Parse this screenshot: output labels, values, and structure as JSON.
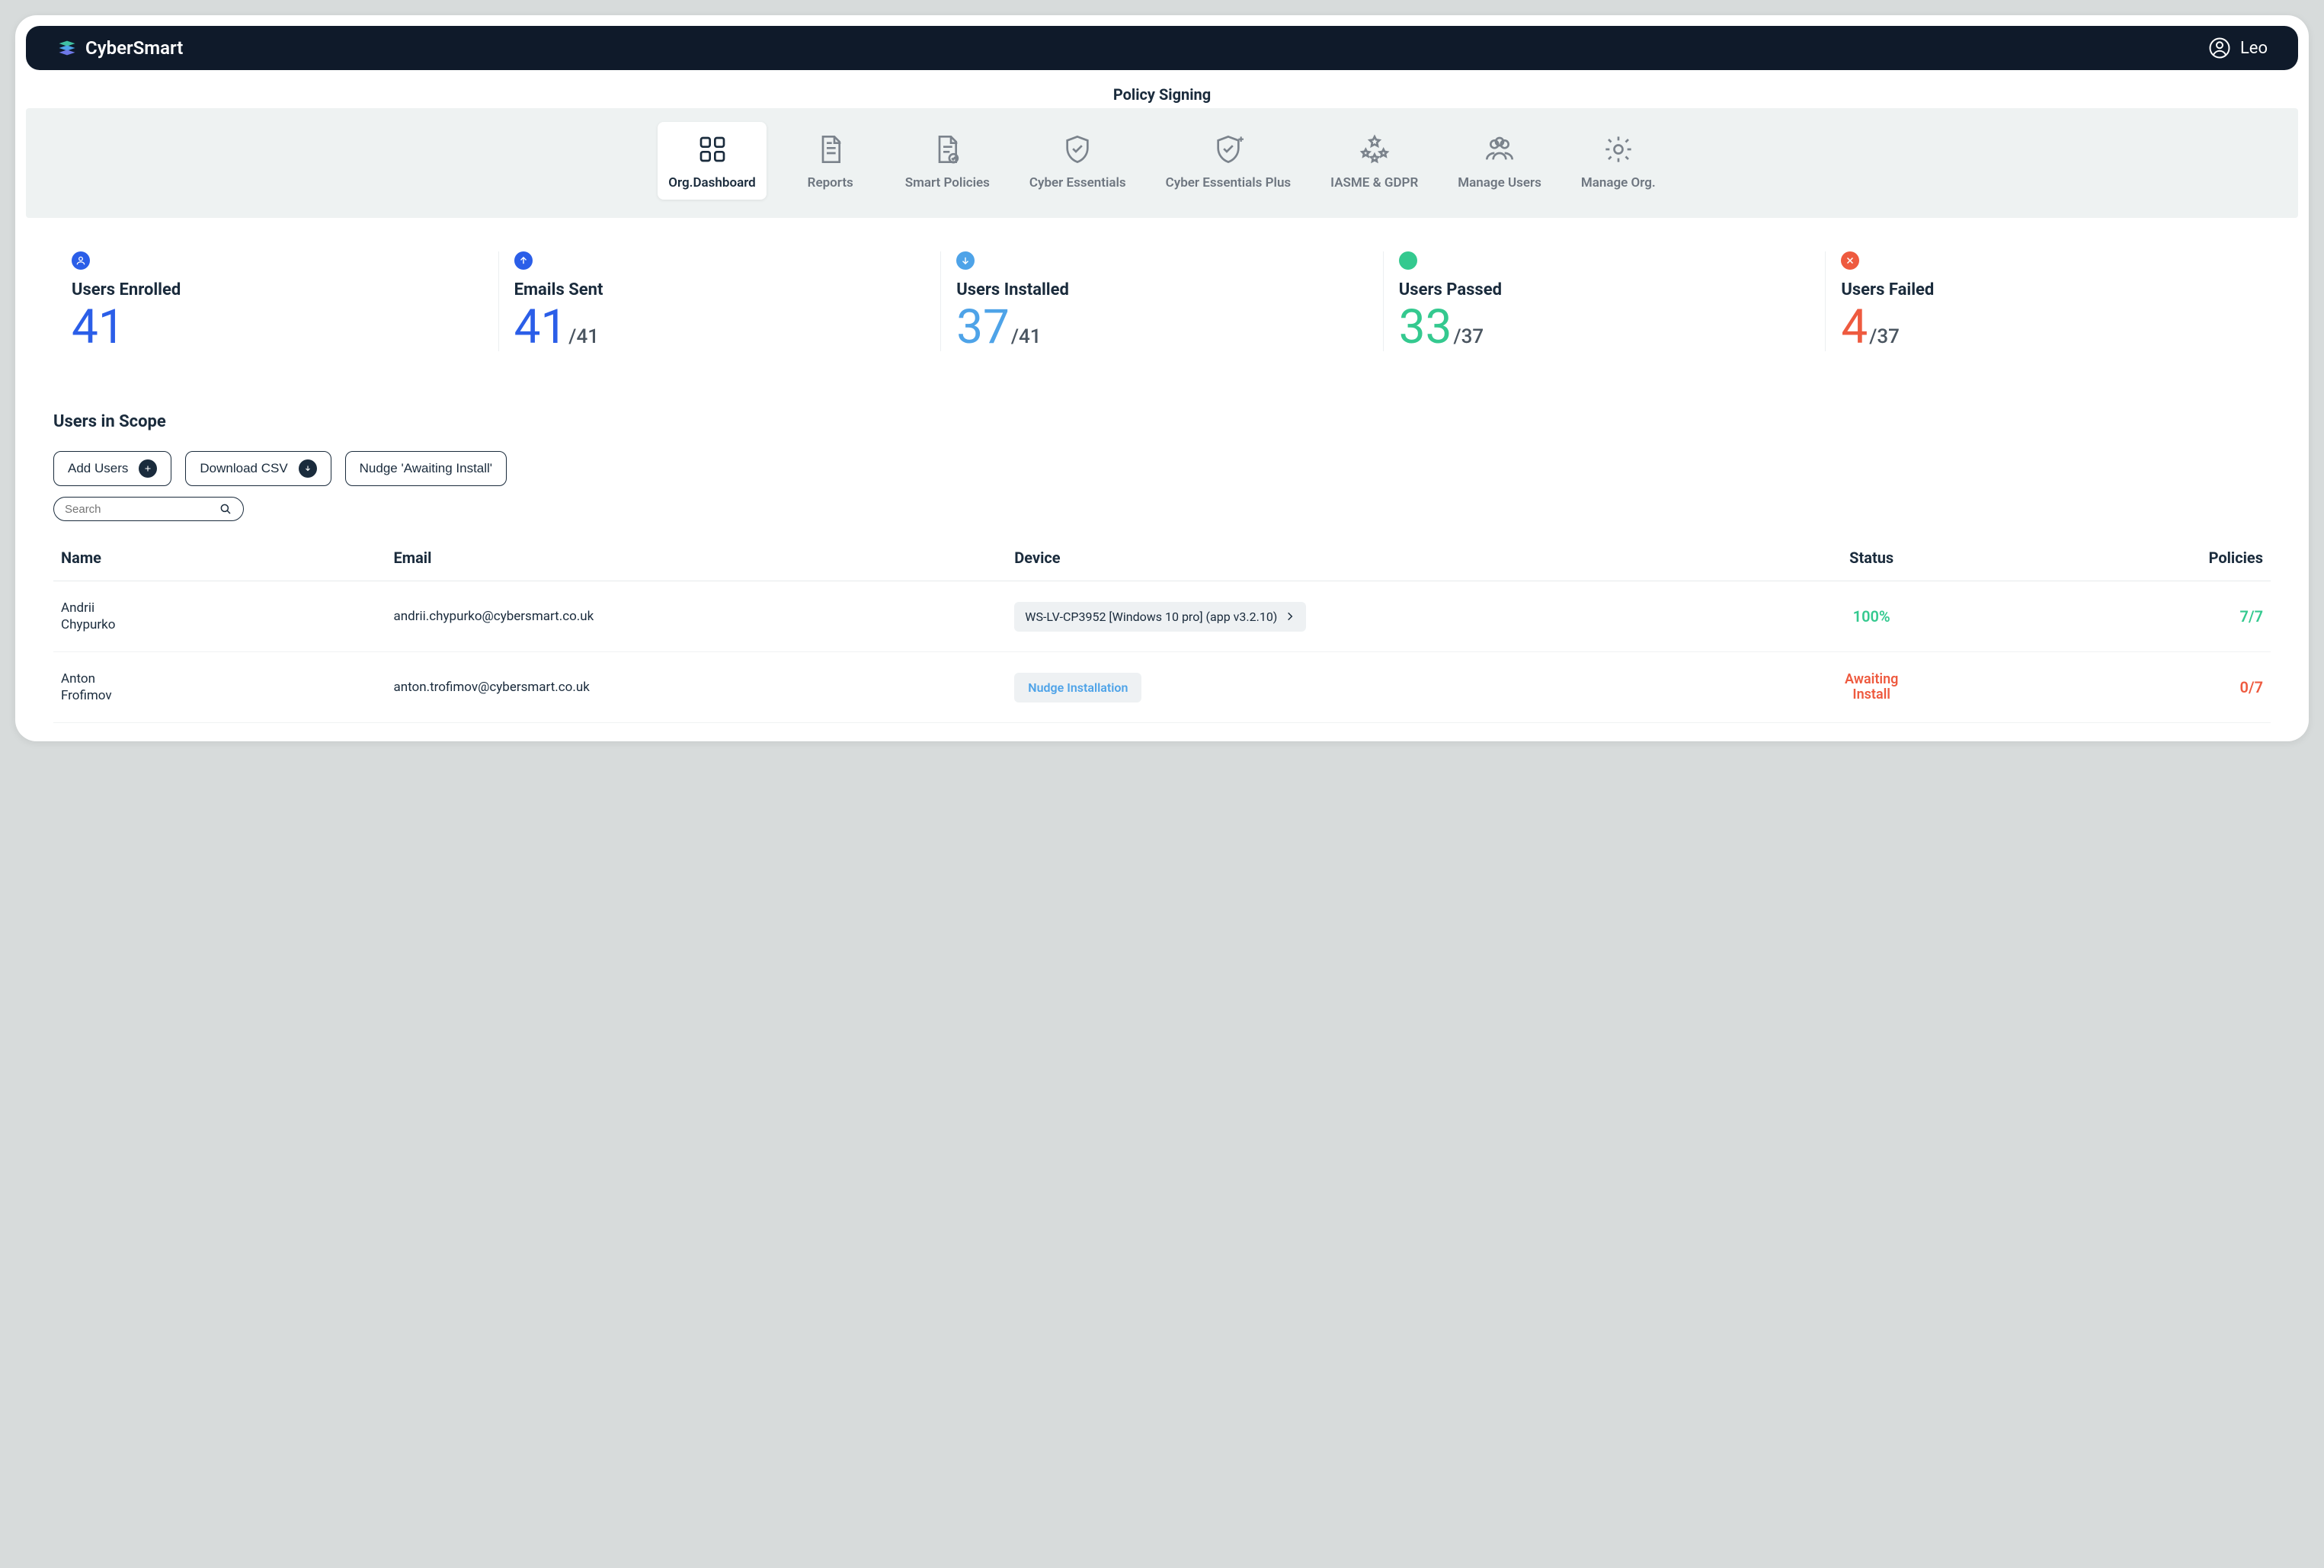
{
  "brand": "CyberSmart",
  "user_name": "Leo",
  "page_title": "Policy Signing",
  "nav": [
    {
      "label": "Org.Dashboard",
      "active": true
    },
    {
      "label": "Reports"
    },
    {
      "label": "Smart Policies"
    },
    {
      "label": "Cyber Essentials"
    },
    {
      "label": "Cyber Essentials Plus"
    },
    {
      "label": "IASME & GDPR"
    },
    {
      "label": "Manage Users"
    },
    {
      "label": "Manage Org."
    }
  ],
  "stats": {
    "enrolled": {
      "label": "Users Enrolled",
      "value": "41"
    },
    "emails": {
      "label": "Emails Sent",
      "value": "41",
      "sub": "/41"
    },
    "installed": {
      "label": "Users Installed",
      "value": "37",
      "sub": "/41"
    },
    "passed": {
      "label": "Users Passed",
      "value": "33",
      "sub": "/37"
    },
    "failed": {
      "label": "Users Failed",
      "value": "4",
      "sub": "/37"
    }
  },
  "panel": {
    "title": "Users in Scope",
    "btn_add": "Add Users",
    "btn_csv": "Download CSV",
    "btn_nudge": "Nudge 'Awaiting Install'",
    "search_placeholder": "Search"
  },
  "table": {
    "headers": {
      "name": "Name",
      "email": "Email",
      "device": "Device",
      "status": "Status",
      "policies": "Policies"
    },
    "rows": [
      {
        "name": "Andrii Chypurko",
        "email": "andrii.chypurko@cybersmart.co.uk",
        "device": "WS-LV-CP3952 [Windows 10 pro] (app v3.2.10)",
        "device_type": "chip",
        "status": "100%",
        "status_class": "pass",
        "policies": "7/7",
        "policies_class": "pass"
      },
      {
        "name": "Anton Frofimov",
        "email": "anton.trofimov@cybersmart.co.uk",
        "device": "Nudge Installation",
        "device_type": "nudge",
        "status": "Awaiting Install",
        "status_class": "await",
        "policies": "0/7",
        "policies_class": "fail"
      }
    ]
  }
}
